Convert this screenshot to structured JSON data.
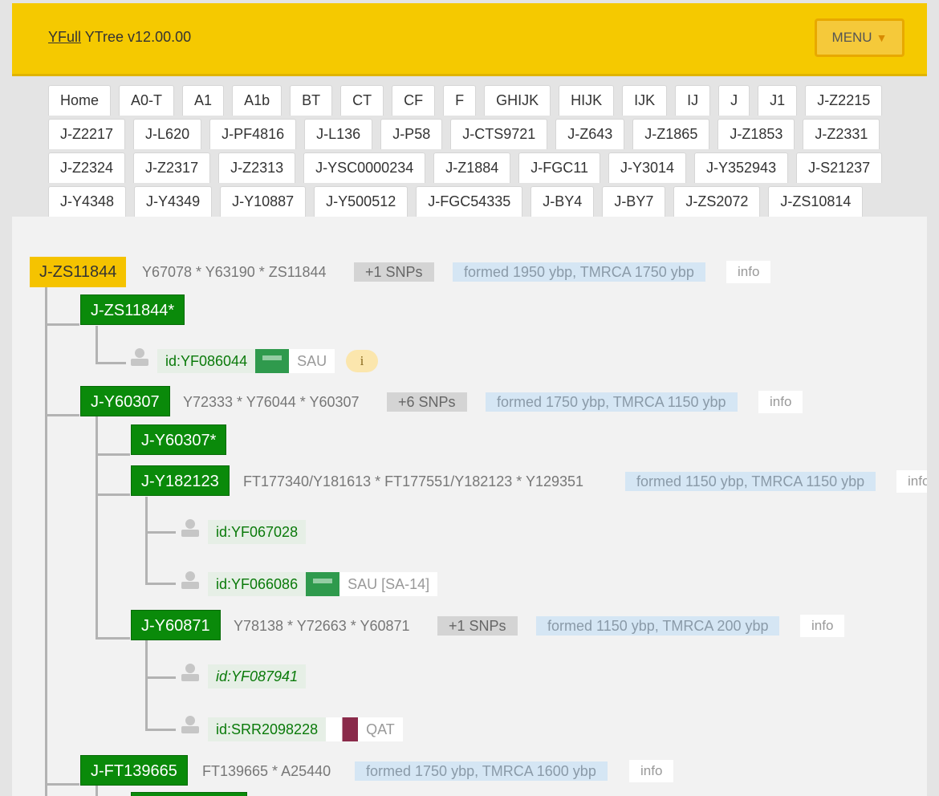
{
  "header": {
    "brand_link": "YFull",
    "brand_rest": " YTree v12.00.00",
    "menu_label": "MENU",
    "menu_caret": "▼"
  },
  "tabs": [
    [
      "Home",
      "A0-T",
      "A1",
      "A1b",
      "BT",
      "CT",
      "CF",
      "F",
      "GHIJK",
      "HIJK",
      "IJK",
      "IJ",
      "J",
      "J1",
      "J-Z2215"
    ],
    [
      "J-Z2217",
      "J-L620",
      "J-PF4816",
      "J-L136",
      "J-P58",
      "J-CTS9721",
      "J-Z643",
      "J-Z1865",
      "J-Z1853",
      "J-Z2331"
    ],
    [
      "J-Z2324",
      "J-Z2317",
      "J-Z2313",
      "J-YSC0000234",
      "J-Z1884",
      "J-FGC11",
      "J-Y3014",
      "J-Y352943",
      "J-S21237"
    ],
    [
      "J-Y4348",
      "J-Y4349",
      "J-Y10887",
      "J-Y500512",
      "J-FGC54335",
      "J-BY4",
      "J-BY7",
      "J-ZS2072",
      "J-ZS10814"
    ]
  ],
  "tree": {
    "root": {
      "name": "J-ZS11844",
      "snps": "Y67078 * Y63190 * ZS11844",
      "snp_count": "+1 SNPs",
      "formed": "formed 1950 ybp, TMRCA 1750 ybp",
      "info": "info"
    },
    "zs11844_star": {
      "name": "J-ZS11844*"
    },
    "sample_yf086044": {
      "id": "id:YF086044",
      "country": "SAU",
      "info_btn": "i"
    },
    "y60307": {
      "name": "J-Y60307",
      "snps": "Y72333 * Y76044 * Y60307",
      "snp_count": "+6 SNPs",
      "formed": "formed 1750 ybp, TMRCA 1150 ybp",
      "info": "info"
    },
    "y60307_star": {
      "name": "J-Y60307*"
    },
    "y182123": {
      "name": "J-Y182123",
      "snps": "FT177340/Y181613 * FT177551/Y182123 * Y129351",
      "formed": "formed 1150 ybp, TMRCA 1150 ybp",
      "info": "info"
    },
    "sample_yf067028": {
      "id": "id:YF067028"
    },
    "sample_yf066086": {
      "id": "id:YF066086",
      "country": "SAU [SA-14]"
    },
    "y60871": {
      "name": "J-Y60871",
      "snps": "Y78138 * Y72663 * Y60871",
      "snp_count": "+1 SNPs",
      "formed": "formed 1150 ybp, TMRCA 200 ybp",
      "info": "info"
    },
    "sample_yf087941": {
      "id": "id:YF087941"
    },
    "sample_srr2098228": {
      "id": "id:SRR2098228",
      "country": "QAT"
    },
    "ft139665": {
      "name": "J-FT139665",
      "snps": "FT139665 * A25440",
      "formed": "formed 1750 ybp, TMRCA 1600 ybp",
      "info": "info"
    }
  },
  "colors": {
    "header": "#f5c900",
    "node_green": "#0a8a0a",
    "node_root": "#f5c300",
    "formed_bg": "#d5e6f4",
    "sample_id": "#0a7a0a"
  },
  "icons": {
    "person": "person-icon",
    "flag_sau": "flag-sau-icon",
    "flag_qat": "flag-qat-icon"
  }
}
